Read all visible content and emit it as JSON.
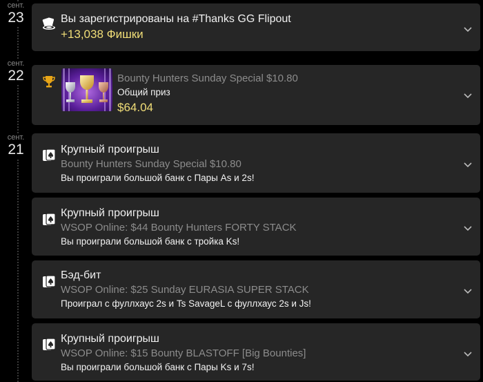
{
  "dates": [
    {
      "month": "сент.",
      "day": "23"
    },
    {
      "month": "сент.",
      "day": "22"
    },
    {
      "month": "сент.",
      "day": "21"
    }
  ],
  "items": [
    {
      "icon": "chips-cards-icon",
      "title": "Вы зарегистрированы на #Thanks GG Flipout",
      "amount": "+13,038 Фишки"
    },
    {
      "icon": "trophy-icon",
      "tournament": "Bounty Hunters Sunday Special $10.80",
      "label": "Общий приз",
      "amount": "$64.04"
    },
    {
      "icon": "playing-card-icon",
      "title": "Крупный проигрыш",
      "tournament": "Bounty Hunters Sunday Special $10.80",
      "detail": "Вы проиграли большой банк с Пары As и 2s!"
    },
    {
      "icon": "playing-card-icon",
      "title": "Крупный проигрыш",
      "tournament": "WSOP Online: $44 Bounty Hunters FORTY STACK",
      "detail": "Вы проиграли большой банк с тройка Ks!"
    },
    {
      "icon": "playing-card-icon",
      "title": "Бэд-бит",
      "tournament": "WSOP Online: $25 Sunday EURASIA SUPER STACK",
      "detail": "Проиграл с фуллхаус 2s и Ts SavageL с фуллхаус 2s и Js!"
    },
    {
      "icon": "playing-card-icon",
      "title": "Крупный проигрыш",
      "tournament": "WSOP Online: $15 Bounty BLASTOFF [Big Bounties]",
      "detail": "Вы проиграли большой банк с Пары Ks и 7s!"
    }
  ],
  "colors": {
    "card": "#262626",
    "gold": "#f1de78",
    "muted": "#8c8c8c"
  }
}
